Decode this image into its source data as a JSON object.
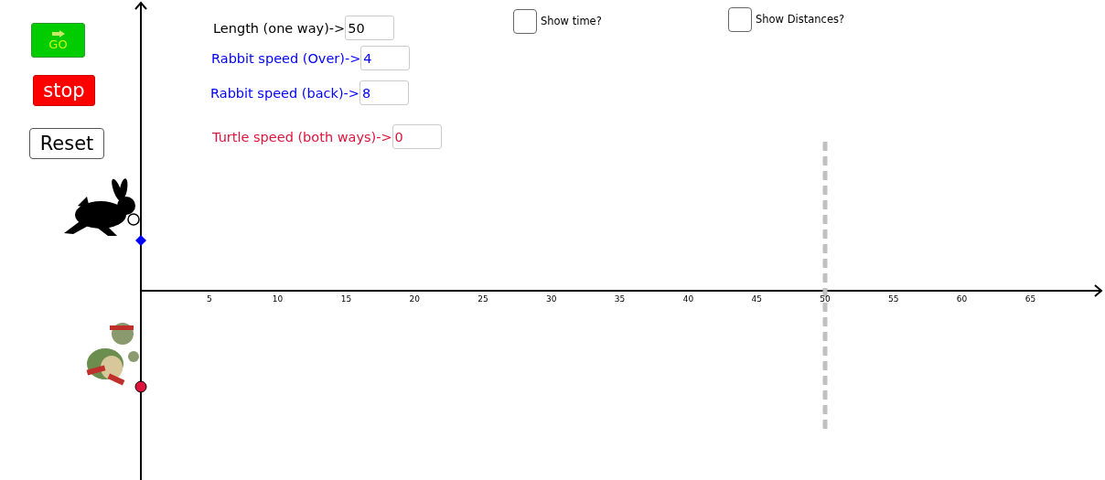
{
  "buttons": [
    {
      "label": "GO",
      "kind": "go"
    },
    {
      "label": "stop",
      "kind": "stop"
    },
    {
      "label": "Reset",
      "kind": "reset"
    }
  ],
  "inputs": [
    {
      "label": "Length (one way)->",
      "value": "50",
      "color": "#000000"
    },
    {
      "label": "Rabbit speed (Over)->",
      "value": "4",
      "color": "#0000ff"
    },
    {
      "label": "Rabbit speed (back)->",
      "value": "8",
      "color": "#0000ff"
    },
    {
      "label": "Turtle speed (both ways)->",
      "value": "0",
      "color": "#dc143c"
    }
  ],
  "checkboxes": [
    {
      "label": "Show time?",
      "checked": false
    },
    {
      "label": "Show Distances?",
      "checked": false
    }
  ],
  "x_axis_ticks": [
    "5",
    "10",
    "15",
    "20",
    "25",
    "30",
    "35",
    "40",
    "45",
    "50",
    "55",
    "60",
    "65"
  ]
}
